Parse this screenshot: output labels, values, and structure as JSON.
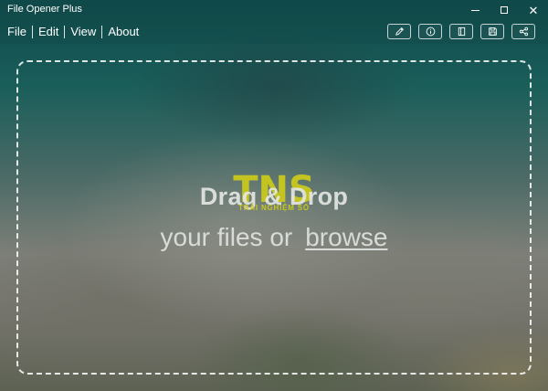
{
  "window": {
    "title": "File Opener Plus",
    "minimize_icon": "minimize-icon",
    "maximize_icon": "maximize-icon",
    "close_icon": "close-icon",
    "close_glyph": "✕"
  },
  "menu": {
    "items": [
      "File",
      "Edit",
      "View",
      "About"
    ]
  },
  "toolbar": {
    "buttons": [
      {
        "icon": "pencil-icon"
      },
      {
        "icon": "info-icon"
      },
      {
        "icon": "book-icon"
      },
      {
        "icon": "save-icon"
      },
      {
        "icon": "share-icon"
      }
    ]
  },
  "dropzone": {
    "title": "Drag & Drop",
    "subtitle_prefix": "your files or",
    "browse_label": "browse"
  },
  "watermark": {
    "logo_text": "TNS",
    "tagline": "TRẢI NGHIỆM SỐ",
    "color": "#c9c81c"
  },
  "colors": {
    "titlebar": "#124848",
    "text": "#ffffff"
  }
}
